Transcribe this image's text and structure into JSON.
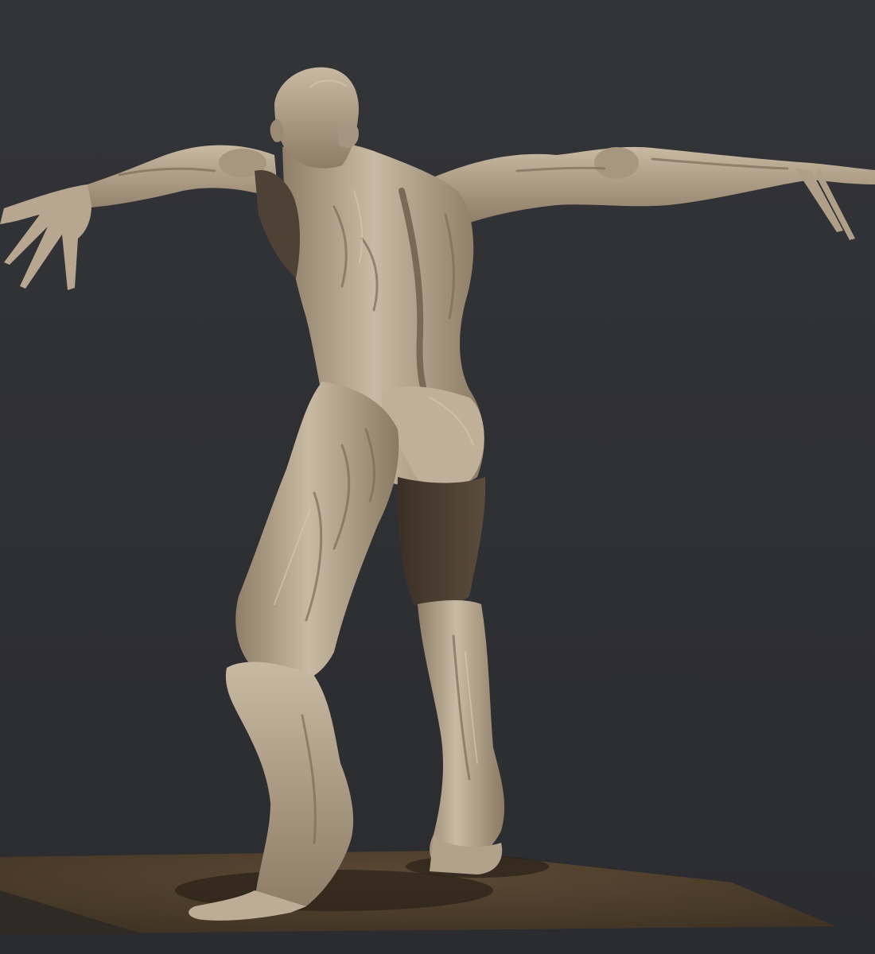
{
  "scene": {
    "subject": "sculpted-creature-back-view",
    "colors": {
      "background": "#2f3033",
      "clay_light": "#c4b5a0",
      "clay_mid": "#9c8b74",
      "clay_shadow": "#5a4c3c",
      "floor": "#4d3e2c",
      "floor_edge": "#3a2e20"
    }
  }
}
